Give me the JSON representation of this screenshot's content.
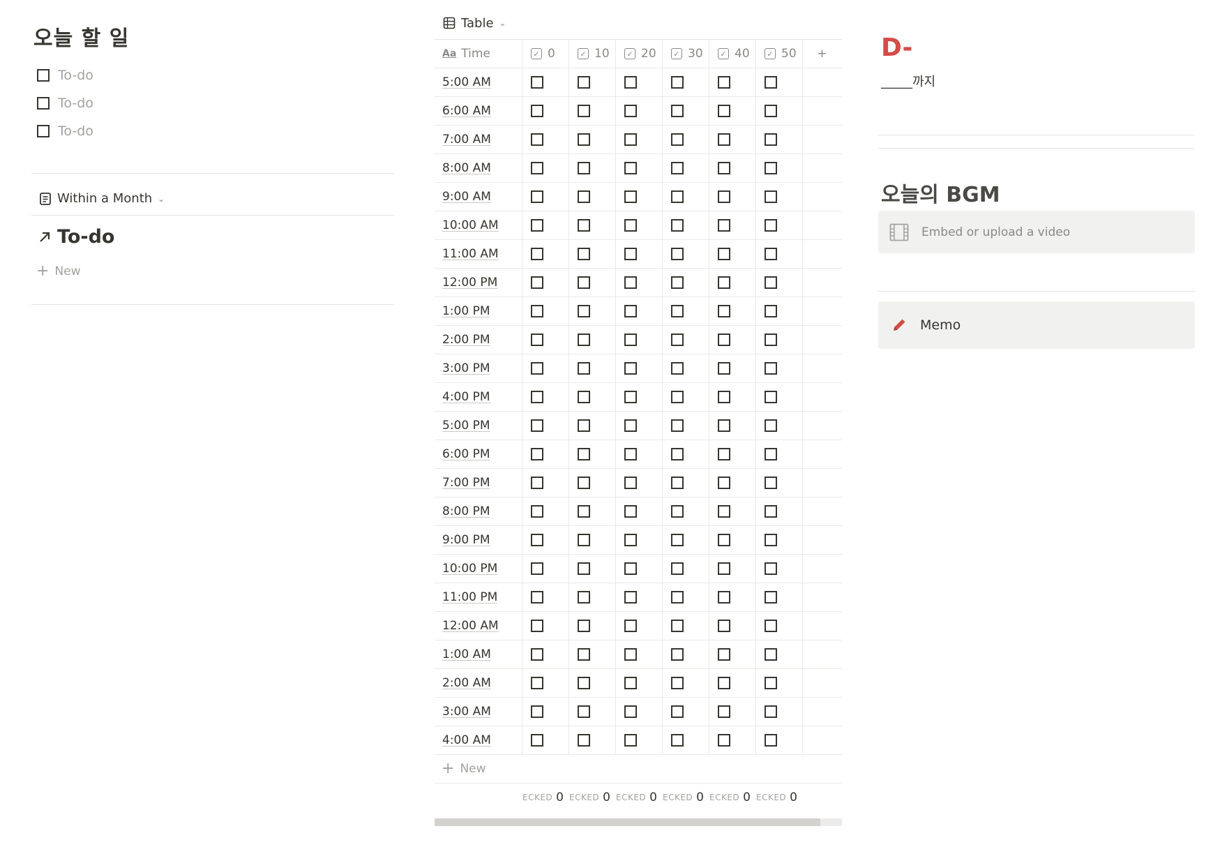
{
  "todo": {
    "heading": "오늘 할 일",
    "items": [
      {
        "label": "To-do",
        "checked": false
      },
      {
        "label": "To-do",
        "checked": false
      },
      {
        "label": "To-do",
        "checked": false
      }
    ]
  },
  "linked_db": {
    "view_label": "Within a Month",
    "title": "To-do",
    "new_label": "New"
  },
  "schedule": {
    "view_label": "Table",
    "time_header": "Time",
    "time_icon": "Aa",
    "column_headers": [
      "0",
      "10",
      "20",
      "30",
      "40",
      "50"
    ],
    "add_column_icon": "+",
    "rows": [
      "5:00 AM",
      "6:00 AM",
      "7:00 AM",
      "8:00 AM",
      "9:00 AM",
      "10:00 AM",
      "11:00 AM",
      "12:00 PM",
      "1:00 PM",
      "2:00 PM",
      "3:00 PM",
      "4:00 PM",
      "5:00 PM",
      "6:00 PM",
      "7:00 PM",
      "8:00 PM",
      "9:00 PM",
      "10:00 PM",
      "11:00 PM",
      "12:00 AM",
      "1:00 AM",
      "2:00 AM",
      "3:00 AM",
      "4:00 AM"
    ],
    "new_label": "New",
    "calc_label": "ECKED",
    "calc_values": [
      "0",
      "0",
      "0",
      "0",
      "0",
      "0"
    ]
  },
  "dday": {
    "title": "D-",
    "until": "_____까지"
  },
  "bgm": {
    "title": "오늘의 BGM",
    "embed_placeholder": "Embed or upload a video"
  },
  "memo": {
    "label": "Memo"
  },
  "colors": {
    "accent_red": "#d44c47",
    "text": "#37352f",
    "muted": "#a3a29e",
    "callout_bg": "#f1f1ef"
  }
}
